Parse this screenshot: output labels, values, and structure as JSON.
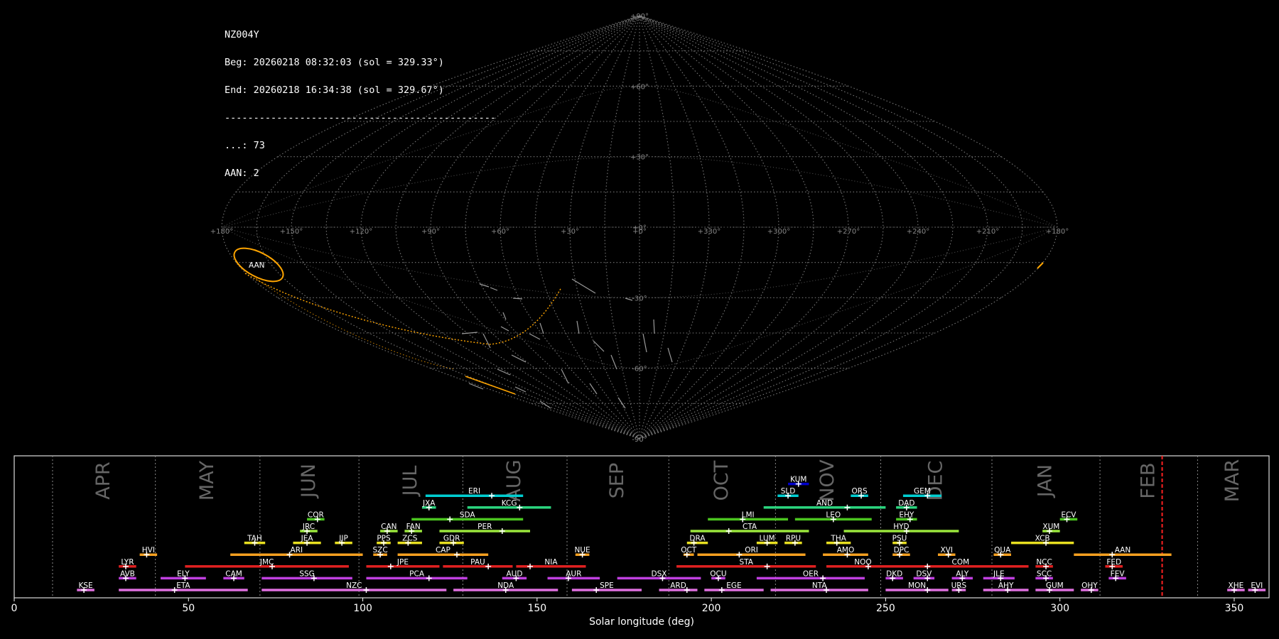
{
  "header": {
    "station": "NZ004Y",
    "beg": "Beg: 20260218 08:32:03 (sol = 329.33°)",
    "end": "End: 20260218 16:34:38 (sol = 329.67°)",
    "separator": "-----------------------------------------------",
    "count_sporadic": "...: 73",
    "count_aan": "AAN: 2"
  },
  "skymap": {
    "lat_labels": [
      "+90°",
      "+60°",
      "+30°",
      "+0°",
      "-30°",
      "-60°",
      "-90°"
    ],
    "lon_labels": [
      "+180°",
      "+150°",
      "+120°",
      "+90°",
      "+60°",
      "+30°",
      "+0°",
      "+330°",
      "+300°",
      "+270°",
      "+240°",
      "+210°",
      "+180°"
    ],
    "radiant_label": "AAN",
    "colors": {
      "grid": "#777777",
      "radiant": "#ffa500",
      "meteor": "#9a9a9a"
    }
  },
  "chart_data": {
    "type": "timeline",
    "xlabel": "Solar longitude (deg)",
    "xlim": [
      0,
      360
    ],
    "xticks": [
      0,
      50,
      100,
      150,
      200,
      250,
      300,
      350
    ],
    "months": [
      {
        "label": "APR",
        "start": 11
      },
      {
        "label": "MAY",
        "start": 40.5
      },
      {
        "label": "JUN",
        "start": 70.5
      },
      {
        "label": "JUL",
        "start": 98.9
      },
      {
        "label": "AUG",
        "start": 128.7
      },
      {
        "label": "SEP",
        "start": 158.6
      },
      {
        "label": "OCT",
        "start": 187.8
      },
      {
        "label": "NOV",
        "start": 218.4
      },
      {
        "label": "DEC",
        "start": 248.6
      },
      {
        "label": "JAN",
        "start": 280.5
      },
      {
        "label": "FEB",
        "start": 311.5
      },
      {
        "label": "MAR",
        "start": 339.5
      }
    ],
    "current_sol": 329.33,
    "current_color": "#ff2020",
    "showers": [
      {
        "code": "KUM",
        "start": 222,
        "end": 228,
        "peak": 225,
        "row": 9,
        "color": "#0000cd"
      },
      {
        "code": "ERI",
        "start": 118,
        "end": 146,
        "peak": 137,
        "row": 8,
        "color": "#00ced1"
      },
      {
        "code": "SLD",
        "start": 219,
        "end": 225,
        "peak": 222,
        "row": 8,
        "color": "#00ced1"
      },
      {
        "code": "ORS",
        "start": 240,
        "end": 245,
        "peak": 243,
        "row": 8,
        "color": "#00ced1"
      },
      {
        "code": "GEM",
        "start": 255,
        "end": 266,
        "peak": 262,
        "row": 8,
        "color": "#00ced1"
      },
      {
        "code": "JXA",
        "start": 117,
        "end": 121,
        "peak": 119,
        "row": 7,
        "color": "#2bd47e"
      },
      {
        "code": "KCG",
        "start": 130,
        "end": 154,
        "peak": 145,
        "row": 7,
        "color": "#2bd47e"
      },
      {
        "code": "AND",
        "start": 215,
        "end": 250,
        "peak": 239,
        "row": 7,
        "color": "#2bd47e"
      },
      {
        "code": "DAD",
        "start": 253,
        "end": 259,
        "peak": 256,
        "row": 7,
        "color": "#2bd47e"
      },
      {
        "code": "COR",
        "start": 84,
        "end": 89,
        "peak": 87,
        "row": 6,
        "color": "#4cc520"
      },
      {
        "code": "SDA",
        "start": 114,
        "end": 146,
        "peak": 125,
        "row": 6,
        "color": "#4cc520"
      },
      {
        "code": "LMI",
        "start": 199,
        "end": 222,
        "peak": 209,
        "row": 6,
        "color": "#4cc520"
      },
      {
        "code": "LEO",
        "start": 224,
        "end": 246,
        "peak": 235,
        "row": 6,
        "color": "#4cc520"
      },
      {
        "code": "EHY",
        "start": 253,
        "end": 259,
        "peak": 257,
        "row": 6,
        "color": "#4cc520"
      },
      {
        "code": "ECV",
        "start": 300,
        "end": 305,
        "peak": 302,
        "row": 6,
        "color": "#4cc520"
      },
      {
        "code": "JRC",
        "start": 82,
        "end": 87,
        "peak": 84,
        "row": 5,
        "color": "#9ae63c"
      },
      {
        "code": "CAN",
        "start": 105,
        "end": 110,
        "peak": 107,
        "row": 5,
        "color": "#9ae63c"
      },
      {
        "code": "FAN",
        "start": 112,
        "end": 117,
        "peak": 114,
        "row": 5,
        "color": "#9ae63c"
      },
      {
        "code": "PER",
        "start": 122,
        "end": 148,
        "peak": 140,
        "row": 5,
        "color": "#9ae63c"
      },
      {
        "code": "CTA",
        "start": 194,
        "end": 228,
        "peak": 205,
        "row": 5,
        "color": "#9ae63c"
      },
      {
        "code": "HYD",
        "start": 238,
        "end": 271,
        "peak": 256,
        "row": 5,
        "color": "#9ae63c"
      },
      {
        "code": "XUM",
        "start": 295,
        "end": 300,
        "peak": 297,
        "row": 5,
        "color": "#9ae63c"
      },
      {
        "code": "TAH",
        "start": 66,
        "end": 72,
        "peak": 69,
        "row": 4,
        "color": "#e8e020"
      },
      {
        "code": "JEA",
        "start": 80,
        "end": 88,
        "peak": 84,
        "row": 4,
        "color": "#e8e020"
      },
      {
        "code": "JIP",
        "start": 92,
        "end": 97,
        "peak": 94,
        "row": 4,
        "color": "#e8e020"
      },
      {
        "code": "PPS",
        "start": 104,
        "end": 108,
        "peak": 106,
        "row": 4,
        "color": "#e8e020"
      },
      {
        "code": "ZCS",
        "start": 110,
        "end": 117,
        "peak": 113,
        "row": 4,
        "color": "#e8e020"
      },
      {
        "code": "GDR",
        "start": 122,
        "end": 129,
        "peak": 126,
        "row": 4,
        "color": "#e8e020"
      },
      {
        "code": "DRA",
        "start": 193,
        "end": 199,
        "peak": 195,
        "row": 4,
        "color": "#e8e020"
      },
      {
        "code": "LUM",
        "start": 213,
        "end": 219,
        "peak": 216,
        "row": 4,
        "color": "#e8e020"
      },
      {
        "code": "RPU",
        "start": 221,
        "end": 226,
        "peak": 224,
        "row": 4,
        "color": "#e8e020"
      },
      {
        "code": "THA",
        "start": 233,
        "end": 240,
        "peak": 236,
        "row": 4,
        "color": "#e8e020"
      },
      {
        "code": "PSU",
        "start": 252,
        "end": 256,
        "peak": 254,
        "row": 4,
        "color": "#e8e020"
      },
      {
        "code": "XCB",
        "start": 286,
        "end": 304,
        "peak": 296,
        "row": 4,
        "color": "#e8e020"
      },
      {
        "code": "HVI",
        "start": 36,
        "end": 41,
        "peak": 38,
        "row": 3,
        "color": "#f5a020"
      },
      {
        "code": "ARI",
        "start": 62,
        "end": 100,
        "peak": 79,
        "row": 3,
        "color": "#f5a020"
      },
      {
        "code": "SZC",
        "start": 103,
        "end": 107,
        "peak": 105,
        "row": 3,
        "color": "#f5a020"
      },
      {
        "code": "CAP",
        "start": 110,
        "end": 136,
        "peak": 127,
        "row": 3,
        "color": "#f5a020"
      },
      {
        "code": "NUE",
        "start": 161,
        "end": 165,
        "peak": 163,
        "row": 3,
        "color": "#f5a020"
      },
      {
        "code": "OCT",
        "start": 192,
        "end": 195,
        "peak": 193,
        "row": 3,
        "color": "#f5a020"
      },
      {
        "code": "ORI",
        "start": 196,
        "end": 227,
        "peak": 208,
        "row": 3,
        "color": "#f5a020"
      },
      {
        "code": "AMO",
        "start": 232,
        "end": 245,
        "peak": 239,
        "row": 3,
        "color": "#f5a020"
      },
      {
        "code": "DPC",
        "start": 252,
        "end": 257,
        "peak": 254,
        "row": 3,
        "color": "#f5a020"
      },
      {
        "code": "XVI",
        "start": 265,
        "end": 270,
        "peak": 268,
        "row": 3,
        "color": "#f5a020"
      },
      {
        "code": "QUA",
        "start": 281,
        "end": 286,
        "peak": 283,
        "row": 3,
        "color": "#f5a020"
      },
      {
        "code": "AAN",
        "start": 304,
        "end": 332,
        "peak": 315,
        "row": 3,
        "color": "#f5a020"
      },
      {
        "code": "LYR",
        "start": 30,
        "end": 35,
        "peak": 32,
        "row": 2,
        "color": "#e02020"
      },
      {
        "code": "JMC",
        "start": 49,
        "end": 96,
        "peak": 74,
        "row": 2,
        "color": "#e02020"
      },
      {
        "code": "JPE",
        "start": 101,
        "end": 122,
        "peak": 108,
        "row": 2,
        "color": "#e02020"
      },
      {
        "code": "PAU",
        "start": 123,
        "end": 143,
        "peak": 136,
        "row": 2,
        "color": "#e02020"
      },
      {
        "code": "NIA",
        "start": 144,
        "end": 164,
        "peak": 148,
        "row": 2,
        "color": "#e02020"
      },
      {
        "code": "STA",
        "start": 190,
        "end": 230,
        "peak": 216,
        "row": 2,
        "color": "#e02020"
      },
      {
        "code": "NOO",
        "start": 233,
        "end": 254,
        "peak": 245,
        "row": 2,
        "color": "#e02020"
      },
      {
        "code": "COM",
        "start": 252,
        "end": 291,
        "peak": 262,
        "row": 2,
        "color": "#e02020"
      },
      {
        "code": "NCC",
        "start": 293,
        "end": 298,
        "peak": 296,
        "row": 2,
        "color": "#e02020"
      },
      {
        "code": "FED",
        "start": 313,
        "end": 318,
        "peak": 315,
        "row": 2,
        "color": "#e02020"
      },
      {
        "code": "AVB",
        "start": 30,
        "end": 35,
        "peak": 32,
        "row": 1,
        "color": "#c040e0"
      },
      {
        "code": "ELY",
        "start": 42,
        "end": 55,
        "peak": 49,
        "row": 1,
        "color": "#c040e0"
      },
      {
        "code": "CAM",
        "start": 60,
        "end": 66,
        "peak": 63,
        "row": 1,
        "color": "#c040e0"
      },
      {
        "code": "SSG",
        "start": 71,
        "end": 97,
        "peak": 86,
        "row": 1,
        "color": "#c040e0"
      },
      {
        "code": "PCA",
        "start": 101,
        "end": 130,
        "peak": 119,
        "row": 1,
        "color": "#c040e0"
      },
      {
        "code": "AUD",
        "start": 140,
        "end": 147,
        "peak": 144,
        "row": 1,
        "color": "#c040e0"
      },
      {
        "code": "AUR",
        "start": 153,
        "end": 168,
        "peak": 159,
        "row": 1,
        "color": "#c040e0"
      },
      {
        "code": "DSX",
        "start": 173,
        "end": 197,
        "peak": 186,
        "row": 1,
        "color": "#c040e0"
      },
      {
        "code": "OCU",
        "start": 200,
        "end": 204,
        "peak": 202,
        "row": 1,
        "color": "#c040e0"
      },
      {
        "code": "OER",
        "start": 213,
        "end": 244,
        "peak": 232,
        "row": 1,
        "color": "#c040e0"
      },
      {
        "code": "DKD",
        "start": 250,
        "end": 255,
        "peak": 252,
        "row": 1,
        "color": "#c040e0"
      },
      {
        "code": "DSV",
        "start": 258,
        "end": 264,
        "peak": 262,
        "row": 1,
        "color": "#c040e0"
      },
      {
        "code": "ALY",
        "start": 269,
        "end": 275,
        "peak": 272,
        "row": 1,
        "color": "#c040e0"
      },
      {
        "code": "JLE",
        "start": 278,
        "end": 287,
        "peak": 283,
        "row": 1,
        "color": "#c040e0"
      },
      {
        "code": "SCC",
        "start": 293,
        "end": 298,
        "peak": 296,
        "row": 1,
        "color": "#c040e0"
      },
      {
        "code": "FEV",
        "start": 314,
        "end": 319,
        "peak": 316,
        "row": 1,
        "color": "#c040e0"
      },
      {
        "code": "KSE",
        "start": 18,
        "end": 23,
        "peak": 20,
        "row": 0,
        "color": "#e070e0"
      },
      {
        "code": "ETA",
        "start": 30,
        "end": 67,
        "peak": 46,
        "row": 0,
        "color": "#e070e0"
      },
      {
        "code": "NZC",
        "start": 71,
        "end": 124,
        "peak": 101,
        "row": 0,
        "color": "#e070e0"
      },
      {
        "code": "NDA",
        "start": 126,
        "end": 156,
        "peak": 141,
        "row": 0,
        "color": "#e070e0"
      },
      {
        "code": "SPE",
        "start": 160,
        "end": 180,
        "peak": 167,
        "row": 0,
        "color": "#e070e0"
      },
      {
        "code": "ARD",
        "start": 185,
        "end": 196,
        "peak": 193,
        "row": 0,
        "color": "#e070e0"
      },
      {
        "code": "EGE",
        "start": 198,
        "end": 215,
        "peak": 203,
        "row": 0,
        "color": "#e070e0"
      },
      {
        "code": "NTA",
        "start": 217,
        "end": 245,
        "peak": 233,
        "row": 0,
        "color": "#e070e0"
      },
      {
        "code": "MON",
        "start": 250,
        "end": 268,
        "peak": 262,
        "row": 0,
        "color": "#e070e0"
      },
      {
        "code": "URS",
        "start": 269,
        "end": 273,
        "peak": 271,
        "row": 0,
        "color": "#e070e0"
      },
      {
        "code": "AHY",
        "start": 278,
        "end": 291,
        "peak": 285,
        "row": 0,
        "color": "#e070e0"
      },
      {
        "code": "GUM",
        "start": 293,
        "end": 304,
        "peak": 297,
        "row": 0,
        "color": "#e070e0"
      },
      {
        "code": "OHY",
        "start": 306,
        "end": 311,
        "peak": 309,
        "row": 0,
        "color": "#e070e0"
      },
      {
        "code": "XHE",
        "start": 348,
        "end": 353,
        "peak": 350,
        "row": 0,
        "color": "#e070e0"
      },
      {
        "code": "EVI",
        "start": 354,
        "end": 359,
        "peak": 356,
        "row": 0,
        "color": "#e070e0"
      }
    ]
  }
}
